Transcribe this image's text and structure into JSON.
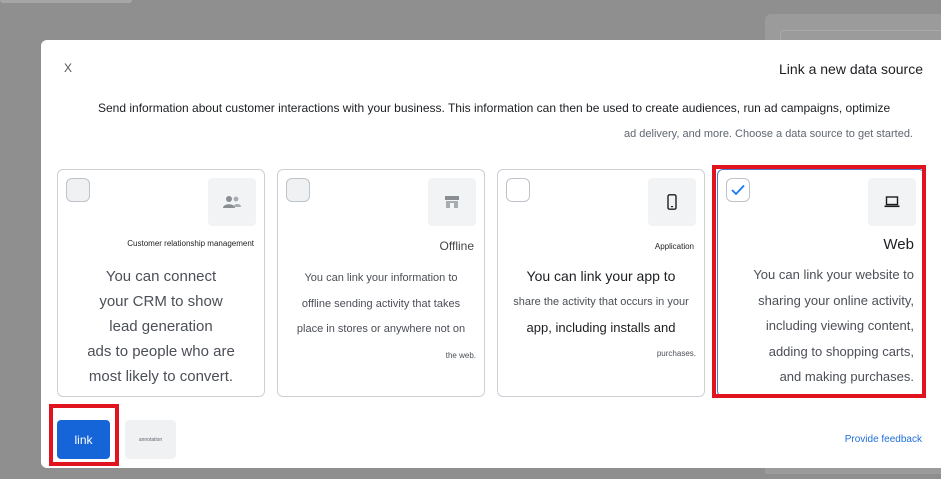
{
  "modal": {
    "close_label": "X",
    "title": "Link a new data source",
    "description_line1": "Send information about customer interactions with your business. This information can then be used to create audiences, run ad campaigns, optimize",
    "description_line2": "ad delivery, and more. Choose a data source to get started."
  },
  "cards": [
    {
      "label": "Customer relationship management",
      "icon": "people-icon",
      "checked": false,
      "lines": [
        "You can connect",
        "your CRM to show",
        "lead generation",
        "ads to people who are",
        "most likely to convert."
      ]
    },
    {
      "label": "Offline",
      "icon": "store-icon",
      "checked": false,
      "lines": [
        "You can link your information to",
        "offline sending activity that takes",
        "place in stores or anywhere not on",
        "the web."
      ]
    },
    {
      "label": "Application",
      "icon": "phone-icon",
      "checked": false,
      "lines": [
        "You can link your app to",
        "share the activity that occurs in your",
        "app, including installs and",
        "purchases."
      ]
    },
    {
      "label": "Web",
      "icon": "laptop-icon",
      "checked": true,
      "lines": [
        "You can link your website to",
        "sharing your online activity,",
        "including viewing content,",
        "adding to shopping carts,",
        "and making purchases."
      ]
    }
  ],
  "footer": {
    "link_label": "link",
    "annotation_label": "annotation",
    "feedback_label": "Provide feedback"
  },
  "colors": {
    "primary_button": "#1665d8",
    "highlight_border": "#e0131f",
    "checkbox_check": "#1877f2",
    "feedback_link": "#216fdb"
  }
}
